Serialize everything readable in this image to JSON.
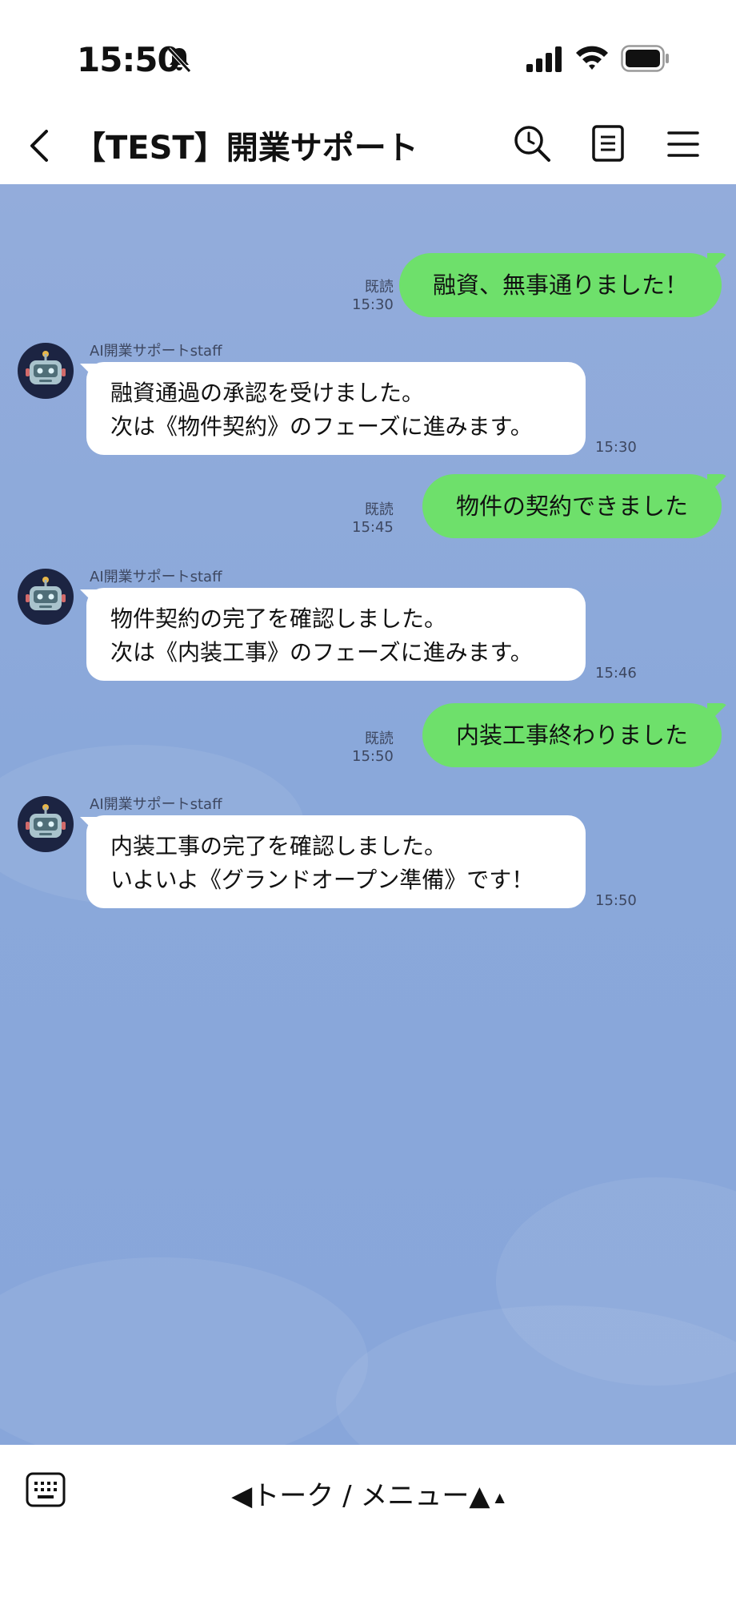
{
  "status_bar": {
    "time": "15:50"
  },
  "header": {
    "title": "【TEST】開業サポート"
  },
  "messages": [
    {
      "type": "out",
      "text": "融資、無事通りました！",
      "read": "既読",
      "time": "15:30"
    },
    {
      "type": "in",
      "sender": "AI開業サポートstaff",
      "lines": [
        "融資通過の承認を受けました。",
        "次は《物件契約》のフェーズに進みます。"
      ],
      "time": "15:30"
    },
    {
      "type": "out",
      "text": "物件の契約できました",
      "read": "既読",
      "time": "15:45"
    },
    {
      "type": "in",
      "sender": "AI開業サポートstaff",
      "lines": [
        "物件契約の完了を確認しました。",
        "次は《内装工事》のフェーズに進みます。"
      ],
      "time": "15:46"
    },
    {
      "type": "out",
      "text": "内装工事終わりました",
      "read": "既読",
      "time": "15:50"
    },
    {
      "type": "in",
      "sender": "AI開業サポートstaff",
      "lines": [
        "内装工事の完了を確認しました。",
        "いよいよ《グランドオープン準備》です！"
      ],
      "time": "15:50"
    }
  ],
  "bottom_bar": {
    "menu_label": "◀トーク / メニュー▲",
    "small_arrow": "▲"
  },
  "colors": {
    "outgoing_bubble": "#6ee06b",
    "chat_background": "#8aa8da",
    "incoming_bubble": "#ffffff"
  }
}
